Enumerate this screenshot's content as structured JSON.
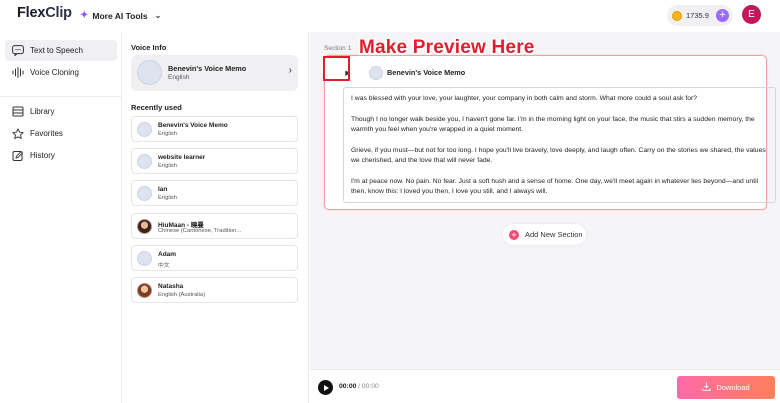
{
  "header": {
    "logo_main": "Flex",
    "logo_accent": "Clip",
    "more_ai_tools": "More AI Tools",
    "credits": "1735.9",
    "avatar_letter": "E"
  },
  "nav": {
    "items": [
      {
        "label": "Text to Speech",
        "icon": "text-to-speech-icon"
      },
      {
        "label": "Voice Cloning",
        "icon": "waveform-icon"
      },
      {
        "label": "Library",
        "icon": "library-icon"
      },
      {
        "label": "Favorites",
        "icon": "star-icon"
      },
      {
        "label": "History",
        "icon": "edit-history-icon"
      }
    ]
  },
  "voice_panel": {
    "voice_info_heading": "Voice Info",
    "current_voice": {
      "name": "Benevin's Voice Memo",
      "language": "English"
    },
    "recently_used_heading": "Recently used",
    "recent": [
      {
        "name": "Benevin's Voice Memo",
        "language": "English"
      },
      {
        "name": "website learner",
        "language": "English"
      },
      {
        "name": "Ian",
        "language": "English"
      },
      {
        "name": "HiuMaan - 曉曼",
        "language": "Chinese (Cantonese, Tradition..."
      },
      {
        "name": "Adam",
        "language": "中文"
      },
      {
        "name": "Natasha",
        "language": "English (Australia)"
      }
    ]
  },
  "editor": {
    "section_label": "Section 1",
    "section_voice": "Benevin's Voice Memo",
    "paragraphs": [
      "I was blessed with your love, your laughter, your company in both calm and storm. What more could a soul ask for?",
      "Though I no longer walk beside you, I haven't gone far. I'm in the morning light on your face, the music that stirs a sudden memory, the warmth you feel when you're wrapped in a quiet moment.",
      "Grieve, if you must—but not for too long. I hope you'll live bravely, love deeply, and laugh often. Carry on the stories we shared, the values we cherished, and the love that will never fade.",
      "I'm at peace now. No pain. No fear. Just a soft hush and a sense of home. One day, we'll meet again in whatever lies beyond—and until then, know this: I loved you then, I love you still, and I always will."
    ],
    "annotation": "Make Preview Here",
    "add_section": "Add New Section"
  },
  "player": {
    "current_time": "00:00",
    "total_time": "/ 00:00",
    "download_label": "Download"
  }
}
